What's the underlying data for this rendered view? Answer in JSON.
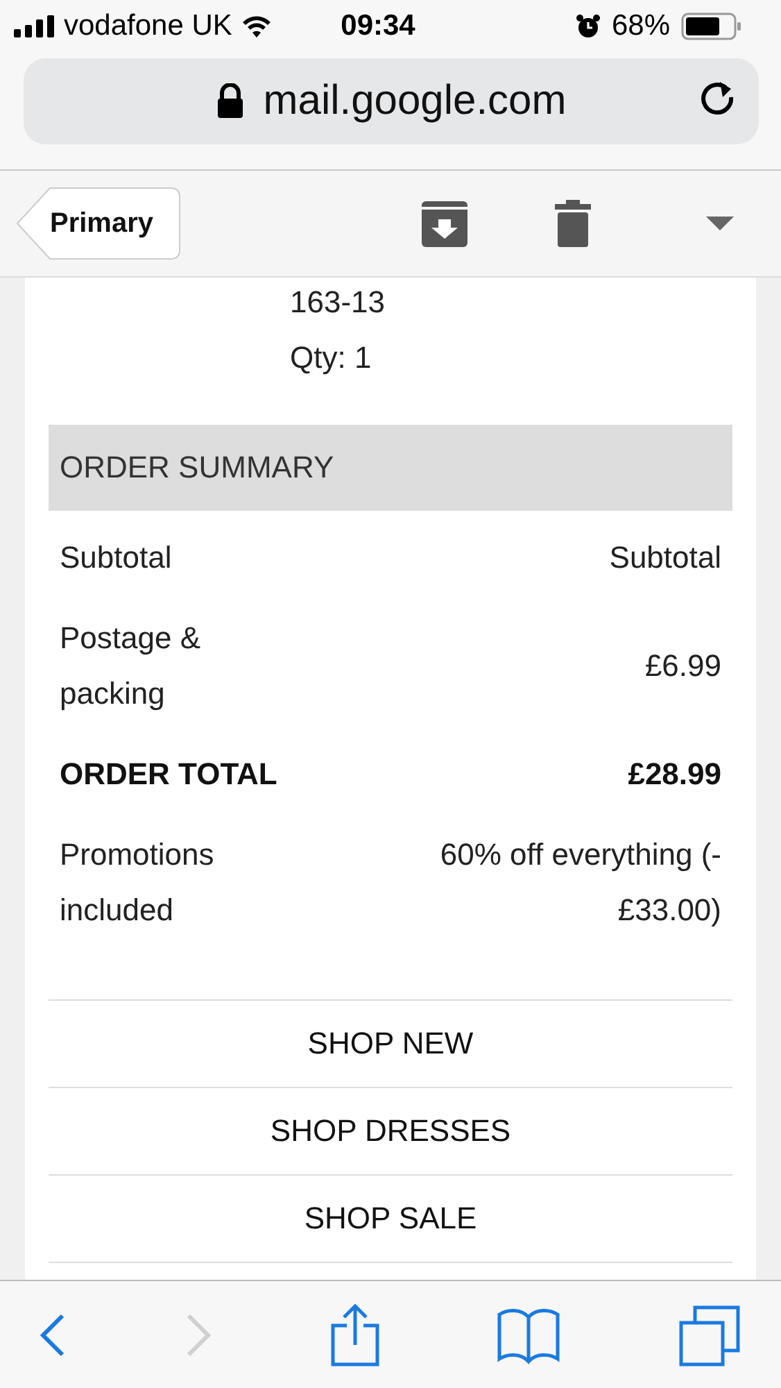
{
  "status_bar": {
    "carrier": "vodafone UK",
    "time": "09:34",
    "battery": "68%"
  },
  "address_bar": {
    "url": "mail.google.com"
  },
  "mail_toolbar": {
    "back_label": "Primary"
  },
  "order": {
    "item_lines": [
      "163-13",
      "Qty: 1"
    ],
    "summary_title": "ORDER SUMMARY",
    "summary_rows": [
      {
        "kind": "plain",
        "label": "Subtotal",
        "value": "Subtotal"
      },
      {
        "kind": "plain",
        "label": "Postage & packing",
        "value": "£6.99"
      },
      {
        "kind": "total",
        "label": "ORDER TOTAL",
        "value": "£28.99"
      },
      {
        "kind": "plain",
        "label": "Promotions included",
        "value": "60% off everything (-£33.00)"
      }
    ],
    "links": [
      "SHOP NEW",
      "SHOP DRESSES",
      "SHOP SALE"
    ]
  },
  "browser_toolbar": {
    "back_disabled": false,
    "forward_disabled": true
  }
}
